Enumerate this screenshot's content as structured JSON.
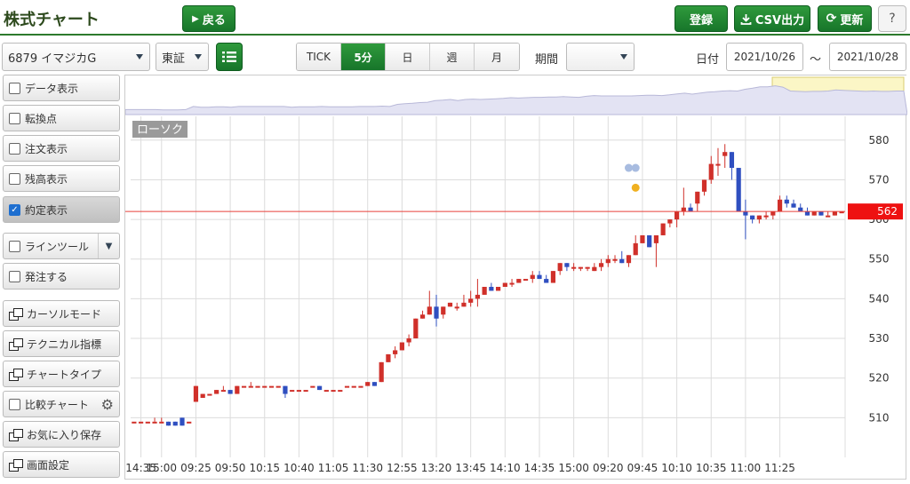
{
  "header": {
    "title": "株式チャート",
    "back_label": "戻る",
    "register_label": "登録",
    "csv_label": "CSV出力",
    "refresh_label": "更新",
    "help_label": "?"
  },
  "toolbar": {
    "stock": "6879 イマジカG",
    "market": "東証",
    "periods": [
      {
        "label": "TICK",
        "active": false
      },
      {
        "label": "5分",
        "active": true
      },
      {
        "label": "日",
        "active": false
      },
      {
        "label": "週",
        "active": false
      },
      {
        "label": "月",
        "active": false
      }
    ],
    "range_label": "期間",
    "range_value": "",
    "date_label": "日付",
    "date_from": "2021/10/26",
    "date_sep": "～",
    "date_to": "2021/10/28"
  },
  "sidebar": [
    {
      "label": "データ表示",
      "kind": "check",
      "checked": false
    },
    {
      "label": "転換点",
      "kind": "check",
      "checked": false
    },
    {
      "label": "注文表示",
      "kind": "check",
      "checked": false
    },
    {
      "label": "残高表示",
      "kind": "check",
      "checked": false
    },
    {
      "label": "約定表示",
      "kind": "check",
      "checked": true
    },
    {
      "label": "ラインツール",
      "kind": "check-dropdown",
      "checked": false
    },
    {
      "label": "発注する",
      "kind": "check",
      "checked": false
    },
    {
      "label": "カーソルモード",
      "kind": "window"
    },
    {
      "label": "テクニカル指標",
      "kind": "window"
    },
    {
      "label": "チャートタイプ",
      "kind": "window"
    },
    {
      "label": "比較チャート",
      "kind": "check-gear",
      "checked": false
    },
    {
      "label": "お気に入り保存",
      "kind": "window"
    },
    {
      "label": "画面設定",
      "kind": "window"
    }
  ],
  "colors": {
    "accent": "#1f8a33",
    "up": "#d0302a",
    "down": "#2f4fc0",
    "price_line": "#e8403a",
    "grid": "#dcdcdc"
  },
  "chart_data": {
    "type": "candlestick",
    "title": "ローソク",
    "current_price": 562,
    "ylim": [
      500,
      586
    ],
    "y_ticks": [
      510,
      520,
      530,
      540,
      550,
      560,
      570,
      580
    ],
    "x_ticks": [
      "14:35",
      "15:00",
      "09:25",
      "09:50",
      "10:15",
      "10:40",
      "11:05",
      "11:30",
      "12:55",
      "13:20",
      "13:45",
      "14:10",
      "14:35",
      "15:00",
      "09:20",
      "09:45",
      "10:10",
      "10:35",
      "11:00",
      "11:25"
    ],
    "x_tick_at": [
      1,
      4,
      9,
      14,
      19,
      24,
      29,
      34,
      39,
      44,
      49,
      54,
      59,
      64,
      69,
      74,
      79,
      84,
      89,
      94
    ],
    "candles": [
      [
        509,
        509,
        509,
        509
      ],
      [
        509,
        509,
        509,
        509
      ],
      [
        509,
        509,
        509,
        509
      ],
      [
        509,
        510,
        509,
        509
      ],
      [
        509,
        510,
        509,
        509
      ],
      [
        509,
        509,
        508,
        508
      ],
      [
        509,
        509,
        508,
        508
      ],
      [
        510,
        510,
        508,
        508
      ],
      [
        509,
        509,
        509,
        509
      ],
      [
        514,
        518,
        514,
        518
      ],
      [
        515,
        516,
        515,
        516
      ],
      [
        516,
        516,
        516,
        516
      ],
      [
        516,
        517,
        516,
        517
      ],
      [
        517,
        518,
        517,
        517
      ],
      [
        517,
        517,
        516,
        516
      ],
      [
        516,
        518,
        516,
        518
      ],
      [
        518,
        518,
        518,
        518
      ],
      [
        518,
        519,
        518,
        518
      ],
      [
        518,
        518,
        518,
        518
      ],
      [
        518,
        518,
        518,
        518
      ],
      [
        518,
        518,
        518,
        518
      ],
      [
        518,
        518,
        518,
        518
      ],
      [
        518,
        518,
        515,
        516
      ],
      [
        517,
        517,
        517,
        517
      ],
      [
        517,
        517,
        517,
        517
      ],
      [
        517,
        517,
        517,
        517
      ],
      [
        518,
        518,
        518,
        518
      ],
      [
        518,
        518,
        517,
        517
      ],
      [
        517,
        517,
        517,
        517
      ],
      [
        517,
        517,
        517,
        517
      ],
      [
        517,
        517,
        517,
        517
      ],
      [
        518,
        518,
        518,
        518
      ],
      [
        518,
        518,
        518,
        518
      ],
      [
        518,
        518,
        518,
        518
      ],
      [
        518,
        519,
        518,
        519
      ],
      [
        519,
        519,
        518,
        518
      ],
      [
        519,
        524,
        519,
        524
      ],
      [
        524,
        526,
        524,
        526
      ],
      [
        526,
        528,
        525,
        527
      ],
      [
        527,
        529,
        527,
        529
      ],
      [
        529,
        531,
        528,
        530
      ],
      [
        530,
        535,
        530,
        535
      ],
      [
        535,
        537,
        535,
        536
      ],
      [
        536,
        542,
        536,
        538
      ],
      [
        538,
        541,
        533,
        535
      ],
      [
        536,
        538,
        535,
        538
      ],
      [
        538,
        539,
        538,
        539
      ],
      [
        538,
        539,
        537,
        538
      ],
      [
        538,
        541,
        538,
        539
      ],
      [
        539,
        542,
        538,
        540
      ],
      [
        540,
        545,
        538,
        541
      ],
      [
        541,
        543,
        541,
        543
      ],
      [
        543,
        544,
        542,
        542
      ],
      [
        542,
        543,
        542,
        543
      ],
      [
        543,
        544,
        543,
        544
      ],
      [
        544,
        545,
        543,
        544
      ],
      [
        544,
        545,
        544,
        545
      ],
      [
        545,
        545,
        545,
        545
      ],
      [
        545,
        547,
        544,
        546
      ],
      [
        546,
        547,
        545,
        545
      ],
      [
        545,
        546,
        544,
        544
      ],
      [
        544,
        547,
        544,
        547
      ],
      [
        547,
        549,
        546,
        549
      ],
      [
        549,
        549,
        547,
        548
      ],
      [
        548,
        549,
        547,
        548
      ],
      [
        548,
        548,
        547,
        548
      ],
      [
        548,
        548,
        547,
        548
      ],
      [
        547,
        549,
        547,
        548
      ],
      [
        548,
        550,
        547,
        549
      ],
      [
        549,
        551,
        548,
        550
      ],
      [
        550,
        551,
        549,
        550
      ],
      [
        550,
        552,
        549,
        549
      ],
      [
        549,
        551,
        548,
        551
      ],
      [
        551,
        556,
        551,
        554
      ],
      [
        554,
        556,
        554,
        556
      ],
      [
        556,
        556,
        553,
        553
      ],
      [
        554,
        556,
        548,
        556
      ],
      [
        556,
        559,
        556,
        559
      ],
      [
        559,
        560,
        558,
        560
      ],
      [
        560,
        562,
        558,
        562
      ],
      [
        562,
        568,
        561,
        563
      ],
      [
        563,
        564,
        562,
        562
      ],
      [
        564,
        567,
        562,
        567
      ],
      [
        567,
        570,
        566,
        570
      ],
      [
        570,
        576,
        569,
        574
      ],
      [
        574,
        578,
        571,
        574
      ],
      [
        576,
        579,
        573,
        577
      ],
      [
        577,
        577,
        570,
        573
      ],
      [
        573,
        573,
        562,
        562
      ],
      [
        562,
        565,
        555,
        561
      ],
      [
        561,
        561,
        559,
        560
      ],
      [
        560,
        561,
        559,
        561
      ],
      [
        561,
        562,
        560,
        561
      ],
      [
        561,
        562,
        560,
        562
      ],
      [
        562,
        566,
        562,
        565
      ],
      [
        565,
        566,
        563,
        564
      ],
      [
        564,
        565,
        563,
        563
      ],
      [
        563,
        564,
        562,
        562
      ],
      [
        562,
        563,
        561,
        561
      ],
      [
        561,
        562,
        561,
        562
      ],
      [
        562,
        562,
        561,
        561
      ],
      [
        561,
        562,
        561,
        561
      ],
      [
        561,
        562,
        561,
        562
      ],
      [
        562,
        562,
        562,
        562
      ]
    ],
    "markers": [
      {
        "index": 72,
        "value": 573,
        "color": "#a8bce0"
      },
      {
        "index": 73,
        "value": 573,
        "color": "#a8bce0"
      },
      {
        "index": 73,
        "value": 568,
        "color": "#f0b020"
      }
    ]
  }
}
